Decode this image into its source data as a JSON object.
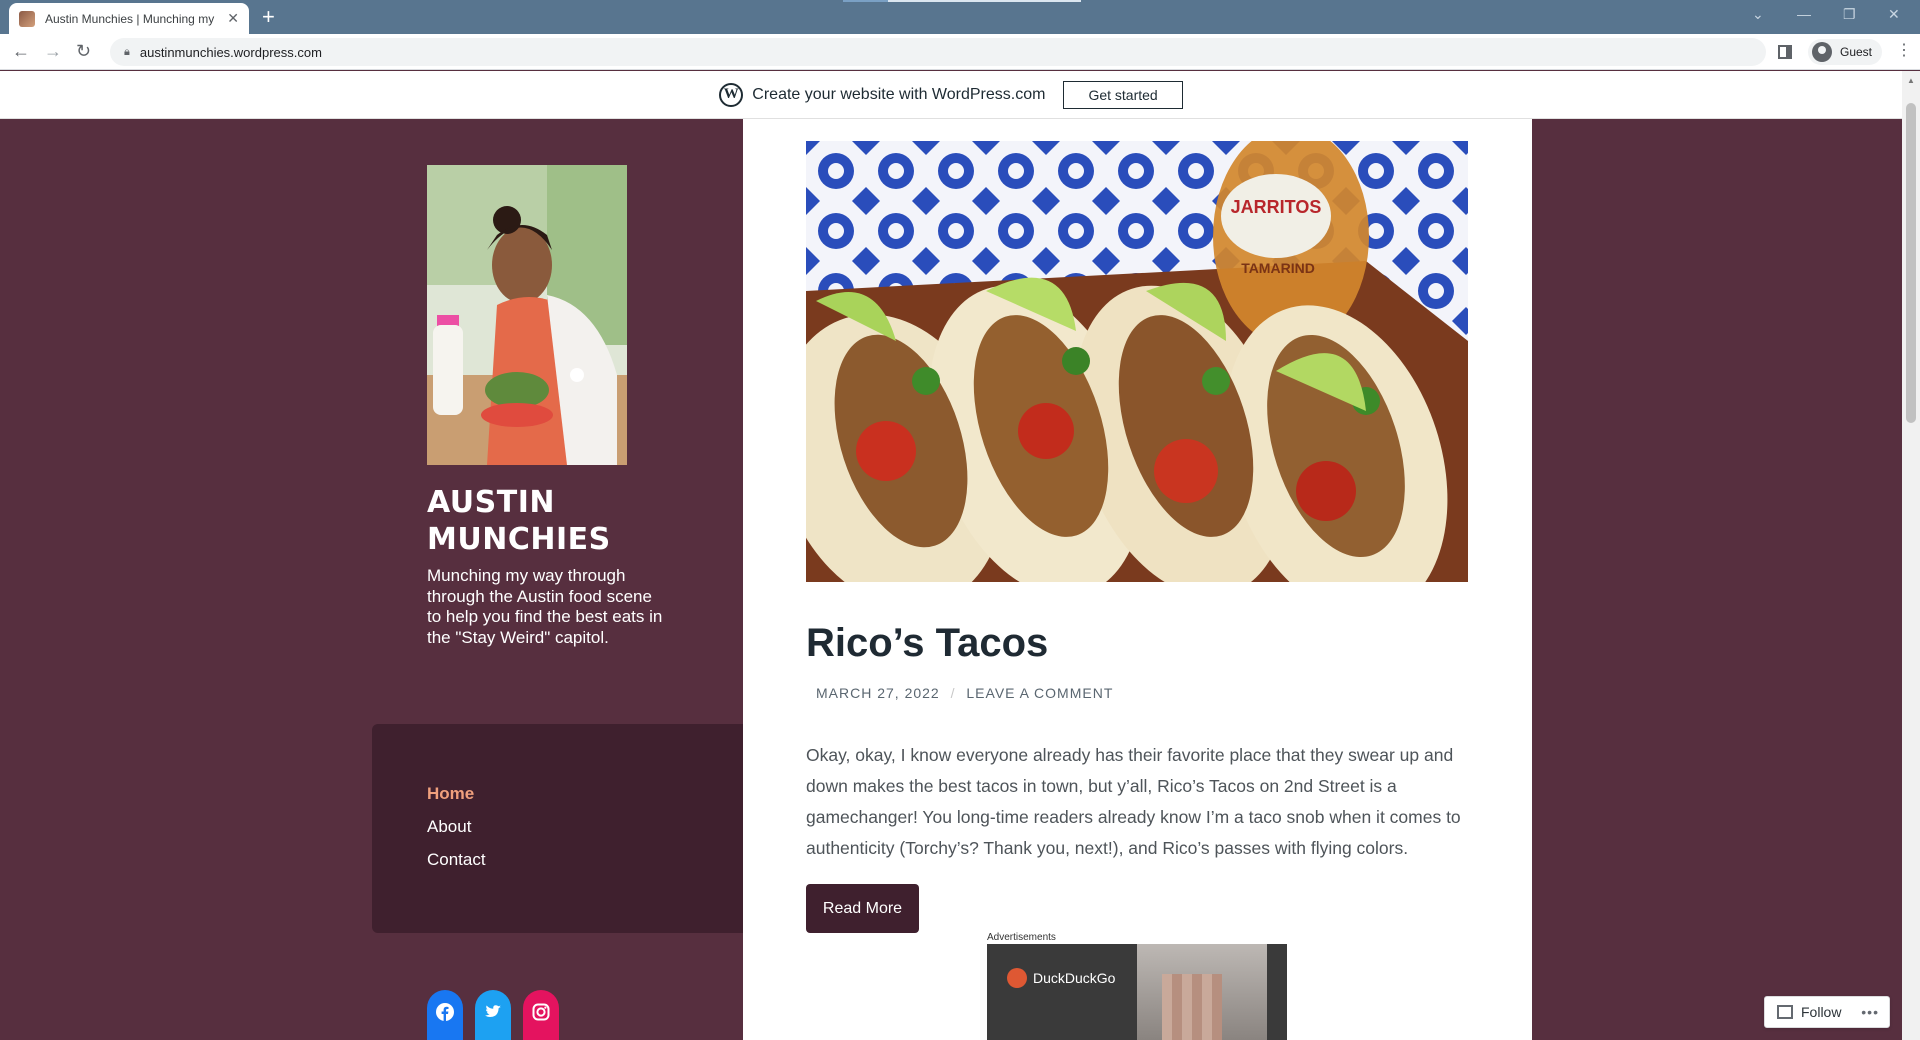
{
  "browser": {
    "tab_title": "Austin Munchies | Munching my",
    "tab_close": "✕",
    "new_tab": "+",
    "url": "austinmunchies.wordpress.com",
    "profile_label": "Guest"
  },
  "wp_banner": {
    "logo": "W",
    "text": "Create your website with WordPress.com",
    "button": "Get started"
  },
  "site": {
    "title": "AUSTIN MUNCHIES",
    "description": "Munching my way through through the Austin food scene to help you find the best eats in the \"Stay Weird\" capitol."
  },
  "nav": {
    "items": [
      {
        "label": "Home",
        "current": true
      },
      {
        "label": "About",
        "current": false
      },
      {
        "label": "Contact",
        "current": false
      }
    ]
  },
  "social": [
    {
      "name": "facebook-icon",
      "color": "#1877f2"
    },
    {
      "name": "twitter-icon",
      "color": "#1da1f2"
    },
    {
      "name": "instagram-icon",
      "color": "#e4135f"
    }
  ],
  "post": {
    "image_text": "JARRITOS",
    "image_subtext": "TAMARIND",
    "title": "Rico’s Tacos",
    "date": "MARCH 27, 2022",
    "separator": "/",
    "comment_link": "LEAVE A COMMENT",
    "excerpt": "Okay, okay, I know everyone already has their favorite place that they swear up and down makes the best tacos in town, but y’all, Rico’s Tacos on 2nd Street is a gamechanger! You long-time readers already know I’m a taco snob when it comes to authenticity (Torchy’s? Thank you, next!), and Rico’s passes with flying colors.",
    "read_more": "Read More"
  },
  "ad": {
    "label": "Advertisements",
    "brand": "DuckDuckGo"
  },
  "follow": {
    "label": "Follow",
    "more": "•••"
  },
  "colors": {
    "page_bg": "#572f3f",
    "nav_bg": "#3f202e",
    "accent": "#f0a07d",
    "tab_bar": "#58758f"
  }
}
